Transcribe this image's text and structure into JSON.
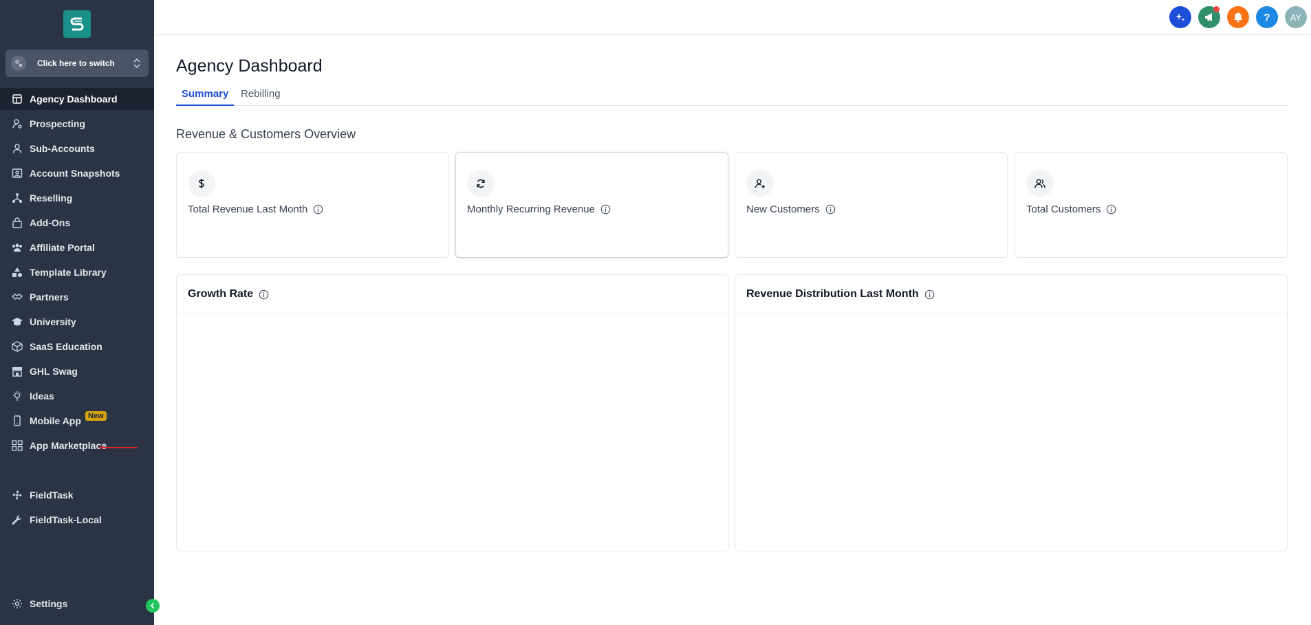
{
  "sidebar": {
    "switcher_label": "Click here to switch",
    "items": [
      {
        "label": "Agency Dashboard",
        "icon": "dashboard-icon"
      },
      {
        "label": "Prospecting",
        "icon": "prospecting-icon"
      },
      {
        "label": "Sub-Accounts",
        "icon": "user-icon"
      },
      {
        "label": "Account Snapshots",
        "icon": "snapshot-icon"
      },
      {
        "label": "Reselling",
        "icon": "reselling-icon"
      },
      {
        "label": "Add-Ons",
        "icon": "bag-icon"
      },
      {
        "label": "Affiliate Portal",
        "icon": "users-group-icon"
      },
      {
        "label": "Template Library",
        "icon": "shapes-icon"
      },
      {
        "label": "Partners",
        "icon": "handshake-icon"
      },
      {
        "label": "University",
        "icon": "graduation-cap-icon"
      },
      {
        "label": "SaaS Education",
        "icon": "box-icon"
      },
      {
        "label": "GHL Swag",
        "icon": "store-icon"
      },
      {
        "label": "Ideas",
        "icon": "lightbulb-icon"
      },
      {
        "label": "Mobile App",
        "icon": "phone-icon",
        "badge": "New"
      },
      {
        "label": "App Marketplace",
        "icon": "grid-icon"
      },
      {
        "label": "FieldTask",
        "icon": "fan-icon"
      },
      {
        "label": "FieldTask-Local",
        "icon": "wrench-icon"
      }
    ],
    "settings_label": "Settings"
  },
  "topbar": {
    "avatar_initials": "AY",
    "help_label": "?",
    "colors": {
      "sparkle": "#1d4ed8",
      "announce": "#2f8f6a",
      "bell": "#f97316",
      "help": "#1e88e5",
      "avatar": "#8cb3b7"
    }
  },
  "main": {
    "title": "Agency Dashboard",
    "tabs": [
      {
        "label": "Summary"
      },
      {
        "label": "Rebilling"
      }
    ],
    "section_title": "Revenue & Customers Overview",
    "cards": [
      {
        "label": "Total Revenue Last Month",
        "icon": "dollar-icon"
      },
      {
        "label": "Monthly Recurring Revenue",
        "icon": "refresh-icon"
      },
      {
        "label": "New Customers",
        "icon": "user-plus-icon"
      },
      {
        "label": "Total Customers",
        "icon": "users-icon"
      }
    ],
    "panels": [
      {
        "title": "Growth Rate"
      },
      {
        "title": "Revenue Distribution Last Month"
      }
    ]
  }
}
